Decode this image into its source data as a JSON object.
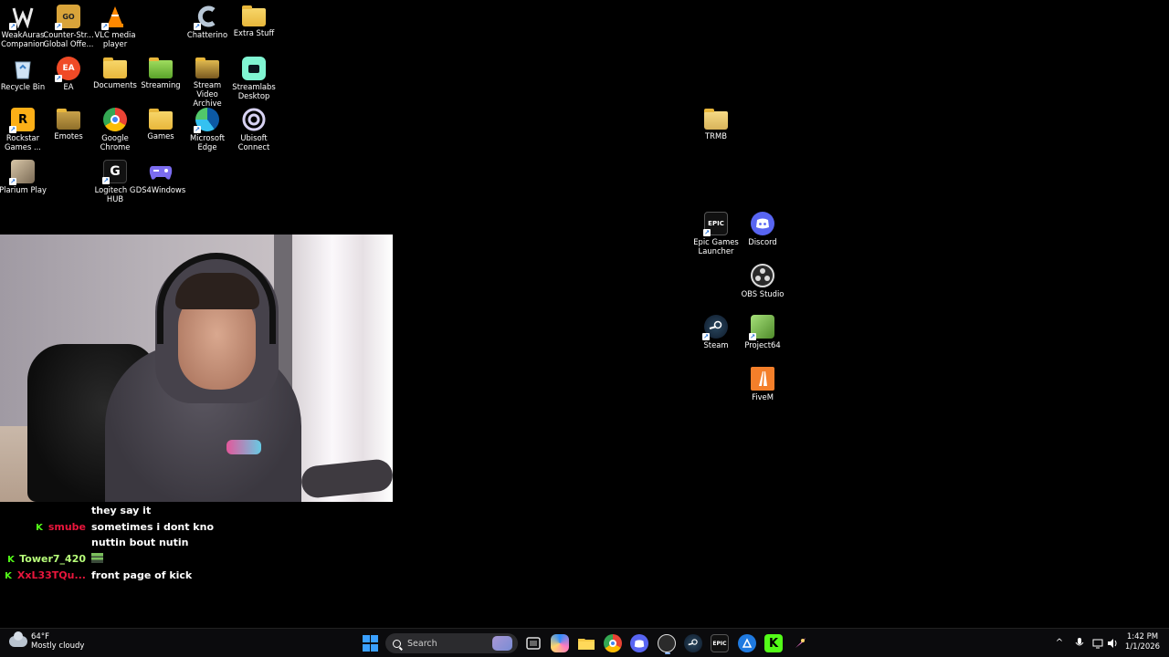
{
  "desktop_icons": [
    {
      "label": "WeakAuras Companion",
      "icon": "weakauras-icon"
    },
    {
      "label": "Counter-Str... Global Offe...",
      "icon": "csgo-icon"
    },
    {
      "label": "VLC media player",
      "icon": "vlc-icon"
    },
    {
      "label": "Chatterino",
      "icon": "chatterino-icon"
    },
    {
      "label": "Extra Stuff",
      "icon": "folder-icon"
    },
    {
      "label": "Recycle Bin",
      "icon": "recycle-bin-icon"
    },
    {
      "label": "EA",
      "icon": "ea-icon"
    },
    {
      "label": "Documents",
      "icon": "folder-icon"
    },
    {
      "label": "Streaming",
      "icon": "folder-icon"
    },
    {
      "label": "Stream Video Archive",
      "icon": "folder-icon"
    },
    {
      "label": "Streamlabs Desktop",
      "icon": "streamlabs-icon"
    },
    {
      "label": "Rockstar Games ...",
      "icon": "rockstar-icon"
    },
    {
      "label": "Emotes",
      "icon": "folder-icon"
    },
    {
      "label": "Google Chrome",
      "icon": "chrome-icon"
    },
    {
      "label": "Games",
      "icon": "folder-icon"
    },
    {
      "label": "Microsoft Edge",
      "icon": "edge-icon"
    },
    {
      "label": "Ubisoft Connect",
      "icon": "ubisoft-icon"
    },
    {
      "label": "Plarium Play",
      "icon": "plarium-icon"
    },
    {
      "label": "Logitech G HUB",
      "icon": "logitech-icon"
    },
    {
      "label": "DS4Windows",
      "icon": "gamepad-icon"
    },
    {
      "label": "TRMB",
      "icon": "folder-icon"
    },
    {
      "label": "Epic Games Launcher",
      "icon": "epic-icon"
    },
    {
      "label": "Discord",
      "icon": "discord-icon"
    },
    {
      "label": "OBS Studio",
      "icon": "obs-icon"
    },
    {
      "label": "Steam",
      "icon": "steam-icon"
    },
    {
      "label": "Project64",
      "icon": "project64-icon"
    },
    {
      "label": "FiveM",
      "icon": "fivem-icon"
    }
  ],
  "chat": [
    {
      "user": "",
      "color": "#ffffff",
      "badge": false,
      "message": "they say it"
    },
    {
      "user": "smube",
      "color": "#e8163c",
      "badge": true,
      "message": "sometimes i dont kno"
    },
    {
      "user": "",
      "color": "#ffffff",
      "badge": false,
      "message": "nuttin bout nutin"
    },
    {
      "user": "Tower7_420",
      "color": "#b7ff7a",
      "badge": true,
      "message": ""
    },
    {
      "user": "XxL33TQu...",
      "color": "#e8163c",
      "badge": true,
      "message": "front page of kick"
    }
  ],
  "chat_badge_glyph": "K",
  "taskbar": {
    "weather_temp": "64°F",
    "weather_desc": "Mostly cloudy",
    "search_placeholder": "Search",
    "time": "1:42 PM",
    "date": "1/1/2026",
    "tray_chevron": "^",
    "apps": [
      {
        "icon": "task-view-icon"
      },
      {
        "icon": "copilot-icon"
      },
      {
        "icon": "file-explorer-icon"
      },
      {
        "icon": "chrome-icon"
      },
      {
        "icon": "discord-icon"
      },
      {
        "icon": "obs-icon"
      },
      {
        "icon": "steam-icon"
      },
      {
        "icon": "epic-icon"
      },
      {
        "icon": "azure-icon"
      },
      {
        "icon": "kick-icon"
      },
      {
        "icon": "rocket-icon"
      }
    ]
  }
}
